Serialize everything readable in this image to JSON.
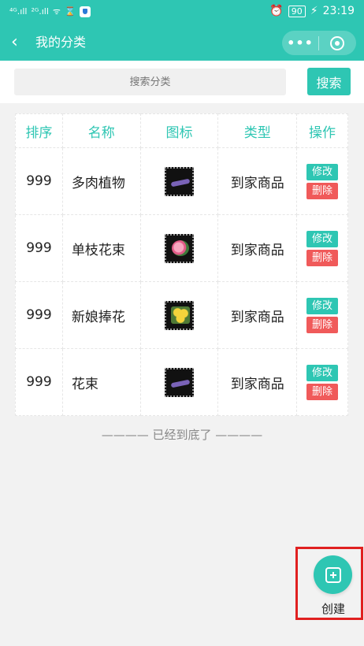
{
  "status": {
    "signal1": "⁴ᴳ.ıll",
    "signal2": "²ᴳ.ıll",
    "wifi": "ᯤ",
    "hourglass": "⌛",
    "alarm": "⏰",
    "battery": "90",
    "charge": "⚡",
    "time": "23:19"
  },
  "nav": {
    "back": "‹",
    "title": "我的分类",
    "more": "•••"
  },
  "search": {
    "placeholder": "搜索分类",
    "button": "搜索"
  },
  "table": {
    "headers": [
      "排序",
      "名称",
      "图标",
      "类型",
      "操作"
    ],
    "rows": [
      {
        "order": "999",
        "name": "多肉植物",
        "type": "到家商品",
        "icon": "lavender-bouquet-icon",
        "edit": "修改",
        "delete": "删除"
      },
      {
        "order": "999",
        "name": "单枝花束",
        "type": "到家商品",
        "icon": "pink-flower-icon",
        "edit": "修改",
        "delete": "删除"
      },
      {
        "order": "999",
        "name": "新娘捧花",
        "type": "到家商品",
        "icon": "yellow-bouquet-icon",
        "edit": "修改",
        "delete": "删除"
      },
      {
        "order": "999",
        "name": "花束",
        "type": "到家商品",
        "icon": "lavender-bouquet-icon",
        "edit": "修改",
        "delete": "删除"
      }
    ]
  },
  "footer": {
    "end_text": "———— 已经到底了 ————"
  },
  "fab": {
    "label": "创建"
  },
  "colors": {
    "accent": "#2ec6b3",
    "danger": "#f05a5a",
    "highlight": "#e02020"
  }
}
